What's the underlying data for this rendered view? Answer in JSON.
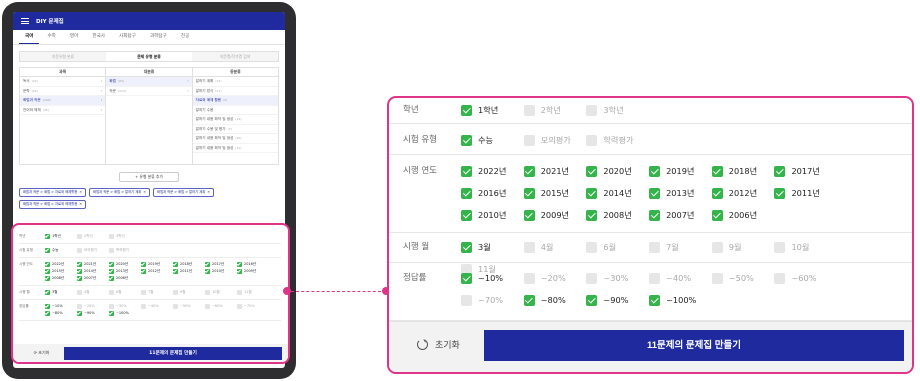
{
  "app": {
    "title": "DIY 문제집"
  },
  "subjects": [
    "국어",
    "수학",
    "영어",
    "한국사",
    "사회탐구",
    "과학탐구",
    "전공"
  ],
  "mode_tabs": [
    "지문유형 분류",
    "문제 유형 분류",
    "지문명/작가명 검색"
  ],
  "columns": {
    "headers": [
      "과목",
      "대분류",
      "중분류"
    ],
    "col1": [
      {
        "label": "독서",
        "count": "(42)"
      },
      {
        "label": "문학",
        "count": "(64)"
      },
      {
        "label": "화법과 작문",
        "count": "(298)"
      },
      {
        "label": "언어와 매체",
        "count": "(45)"
      }
    ],
    "col2": [
      {
        "label": "화법",
        "count": "(83)"
      },
      {
        "label": "작문",
        "count": "(215)"
      }
    ],
    "col3": [
      {
        "label": "말하기 계획",
        "count": "(12)"
      },
      {
        "label": "말하기 방식",
        "count": "(11)"
      },
      {
        "label": "자료와 매체 활용",
        "count": "(6)"
      },
      {
        "label": "말하기 수용",
        "count": ""
      },
      {
        "label": "말하기 내용 파악 및 생성",
        "count": "(12)"
      },
      {
        "label": "말하기 수용 및 평가",
        "count": "(7)"
      },
      {
        "label": "말하기 내용 파악 및 생성",
        "count": "(10)"
      },
      {
        "label": "말하기 내용 파악 및 생성",
        "count": "(11)"
      }
    ]
  },
  "add_type_label": "+ 유형 분류 추가",
  "chips": [
    "화법과 작문 > 화법 > 자료와 매체활용",
    "화법과 작문 > 화법 > 말하기 계획",
    "화법과 작문 > 화법 > 말하기 계획",
    "화법과 작문 > 화법 > 자료와 매체활용"
  ],
  "filters": {
    "grade": {
      "label": "학년",
      "options": [
        {
          "text": "1학년",
          "checked": true
        },
        {
          "text": "2학년",
          "checked": false
        },
        {
          "text": "3학년",
          "checked": false
        }
      ]
    },
    "exam_type": {
      "label": "시험 유형",
      "options": [
        {
          "text": "수능",
          "checked": true
        },
        {
          "text": "모의평가",
          "checked": false
        },
        {
          "text": "학력평가",
          "checked": false
        }
      ]
    },
    "exam_year": {
      "label": "시행 연도",
      "options": [
        {
          "text": "2022년",
          "checked": true
        },
        {
          "text": "2021년",
          "checked": true
        },
        {
          "text": "2020년",
          "checked": true
        },
        {
          "text": "2019년",
          "checked": true
        },
        {
          "text": "2018년",
          "checked": true
        },
        {
          "text": "2017년",
          "checked": true
        },
        {
          "text": "2016년",
          "checked": true
        },
        {
          "text": "2015년",
          "checked": true
        },
        {
          "text": "2014년",
          "checked": true
        },
        {
          "text": "2013년",
          "checked": true
        },
        {
          "text": "2012년",
          "checked": true
        },
        {
          "text": "2011년",
          "checked": true
        },
        {
          "text": "2010년",
          "checked": true
        },
        {
          "text": "2009년",
          "checked": true
        },
        {
          "text": "2008년",
          "checked": true
        },
        {
          "text": "2007년",
          "checked": true
        },
        {
          "text": "2006년",
          "checked": true
        }
      ]
    },
    "exam_month": {
      "label": "시행 월",
      "options": [
        {
          "text": "3월",
          "checked": true
        },
        {
          "text": "4월",
          "checked": false
        },
        {
          "text": "6월",
          "checked": false
        },
        {
          "text": "7월",
          "checked": false
        },
        {
          "text": "9월",
          "checked": false
        },
        {
          "text": "10월",
          "checked": false
        },
        {
          "text": "11월",
          "checked": false
        }
      ]
    },
    "accuracy": {
      "label": "정답률",
      "options": [
        {
          "text": "~10%",
          "checked": true
        },
        {
          "text": "~20%",
          "checked": false
        },
        {
          "text": "~30%",
          "checked": false
        },
        {
          "text": "~40%",
          "checked": false
        },
        {
          "text": "~50%",
          "checked": false
        },
        {
          "text": "~60%",
          "checked": false
        },
        {
          "text": "~70%",
          "checked": false
        },
        {
          "text": "~80%",
          "checked": true
        },
        {
          "text": "~90%",
          "checked": true
        },
        {
          "text": "~100%",
          "checked": true
        }
      ]
    }
  },
  "footer": {
    "reset_label": "초기화",
    "make_label": "11문제의 문제집 만들기"
  },
  "colors": {
    "brand": "#1f2a9e",
    "check": "#34b44a",
    "highlight": "#e0338a"
  }
}
